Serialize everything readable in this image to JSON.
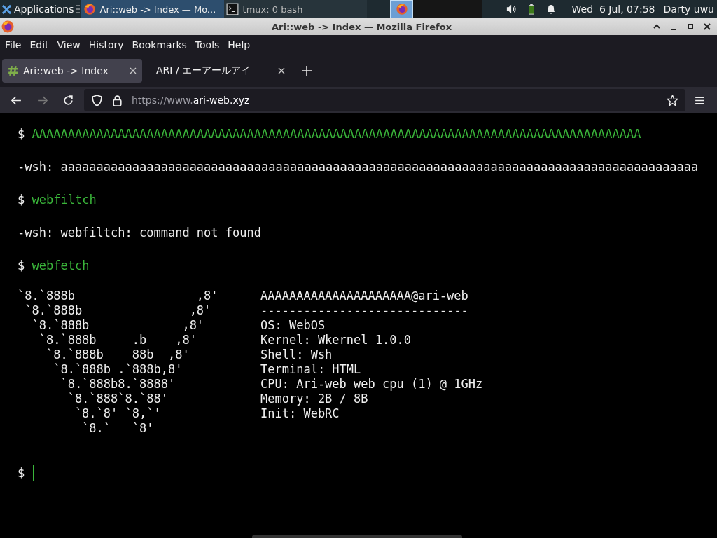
{
  "taskbar": {
    "apps_label": "Applications",
    "tasks": [
      {
        "title": "Ari::web -> Index — Mo...",
        "kind": "browser",
        "selected": true
      },
      {
        "title": "tmux: 0 bash",
        "kind": "terminal",
        "selected": false
      }
    ],
    "workspaces": [
      {
        "selected": true
      },
      {
        "selected": false
      },
      {
        "selected": false
      },
      {
        "selected": false
      }
    ],
    "clock": "Wed  6 Jul, 07:58",
    "user": "Darty uwu"
  },
  "window": {
    "title": "Ari::web -> Index — Mozilla Firefox"
  },
  "menu": [
    "File",
    "Edit",
    "View",
    "History",
    "Bookmarks",
    "Tools",
    "Help"
  ],
  "tabs": [
    {
      "label": "Ari::web -> Index",
      "selected": true
    },
    {
      "label": "ARI / エーアールアイ",
      "selected": false
    }
  ],
  "address_bar": {
    "scheme": "https://www.",
    "host": "ari-web.xyz"
  },
  "terminal": [
    {
      "kind": "command",
      "prompt": "$",
      "text": "AAAAAAAAAAAAAAAAAAAAAAAAAAAAAAAAAAAAAAAAAAAAAAAAAAAAAAAAAAAAAAAAAAAAAAAAAAAAAAAAAAAAA"
    },
    {
      "kind": "output",
      "text": "-wsh: aaaaaaaaaaaaaaaaaaaaaaaaaaaaaaaaaaaaaaaaaaaaaaaaaaaaaaaaaaaaaaaaaaaaaaaaaaaaaaaaaaaaaaaaa"
    },
    {
      "kind": "command",
      "prompt": "$",
      "text": "webfiltch"
    },
    {
      "kind": "output",
      "text": "-wsh: webfiltch: command not found"
    },
    {
      "kind": "command",
      "prompt": "$",
      "text": "webfetch"
    },
    {
      "kind": "fetch",
      "art": [
        "`8.`888b                 ,8'",
        " `8.`888b               ,8'",
        "  `8.`888b             ,8'",
        "   `8.`888b     .b    ,8'",
        "    `8.`888b    88b  ,8'",
        "     `8.`888b .`888b,8'",
        "      `8.`888b8.`8888'",
        "       `8.`888`8.`88'",
        "        `8.`8' `8,`'",
        "         `8.`   `8'"
      ],
      "info": [
        "AAAAAAAAAAAAAAAAAAAAA@ari-web",
        "-----------------------------",
        "OS: WebOS",
        "Kernel: Wkernel 1.0.0",
        "Shell: Wsh",
        "Terminal: HTML",
        "CPU: Ari-web web cpu (1) @ 1GHz",
        "Memory: 2B / 8B",
        "Init: WebRC"
      ]
    },
    {
      "kind": "input",
      "prompt": "$"
    }
  ]
}
